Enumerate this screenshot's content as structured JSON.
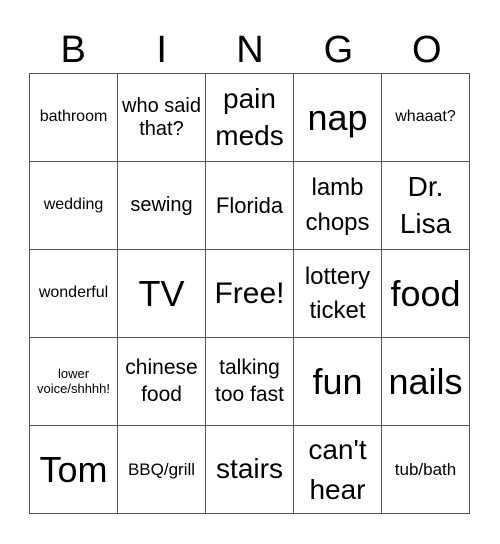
{
  "header": [
    "B",
    "I",
    "N",
    "G",
    "O"
  ],
  "rows": [
    [
      "bathroom",
      "who said that?",
      "pain meds",
      "nap",
      "whaaat?"
    ],
    [
      "wedding",
      "sewing",
      "Florida",
      "lamb chops",
      "Dr. Lisa"
    ],
    [
      "wonderful",
      "TV",
      "Free!",
      "lottery ticket",
      "food"
    ],
    [
      "lower voice/shhhh!",
      "chinese food",
      "talking too fast",
      "fun",
      "nails"
    ],
    [
      "Tom",
      "BBQ/grill",
      "stairs",
      "can't hear",
      "tub/bath"
    ]
  ]
}
